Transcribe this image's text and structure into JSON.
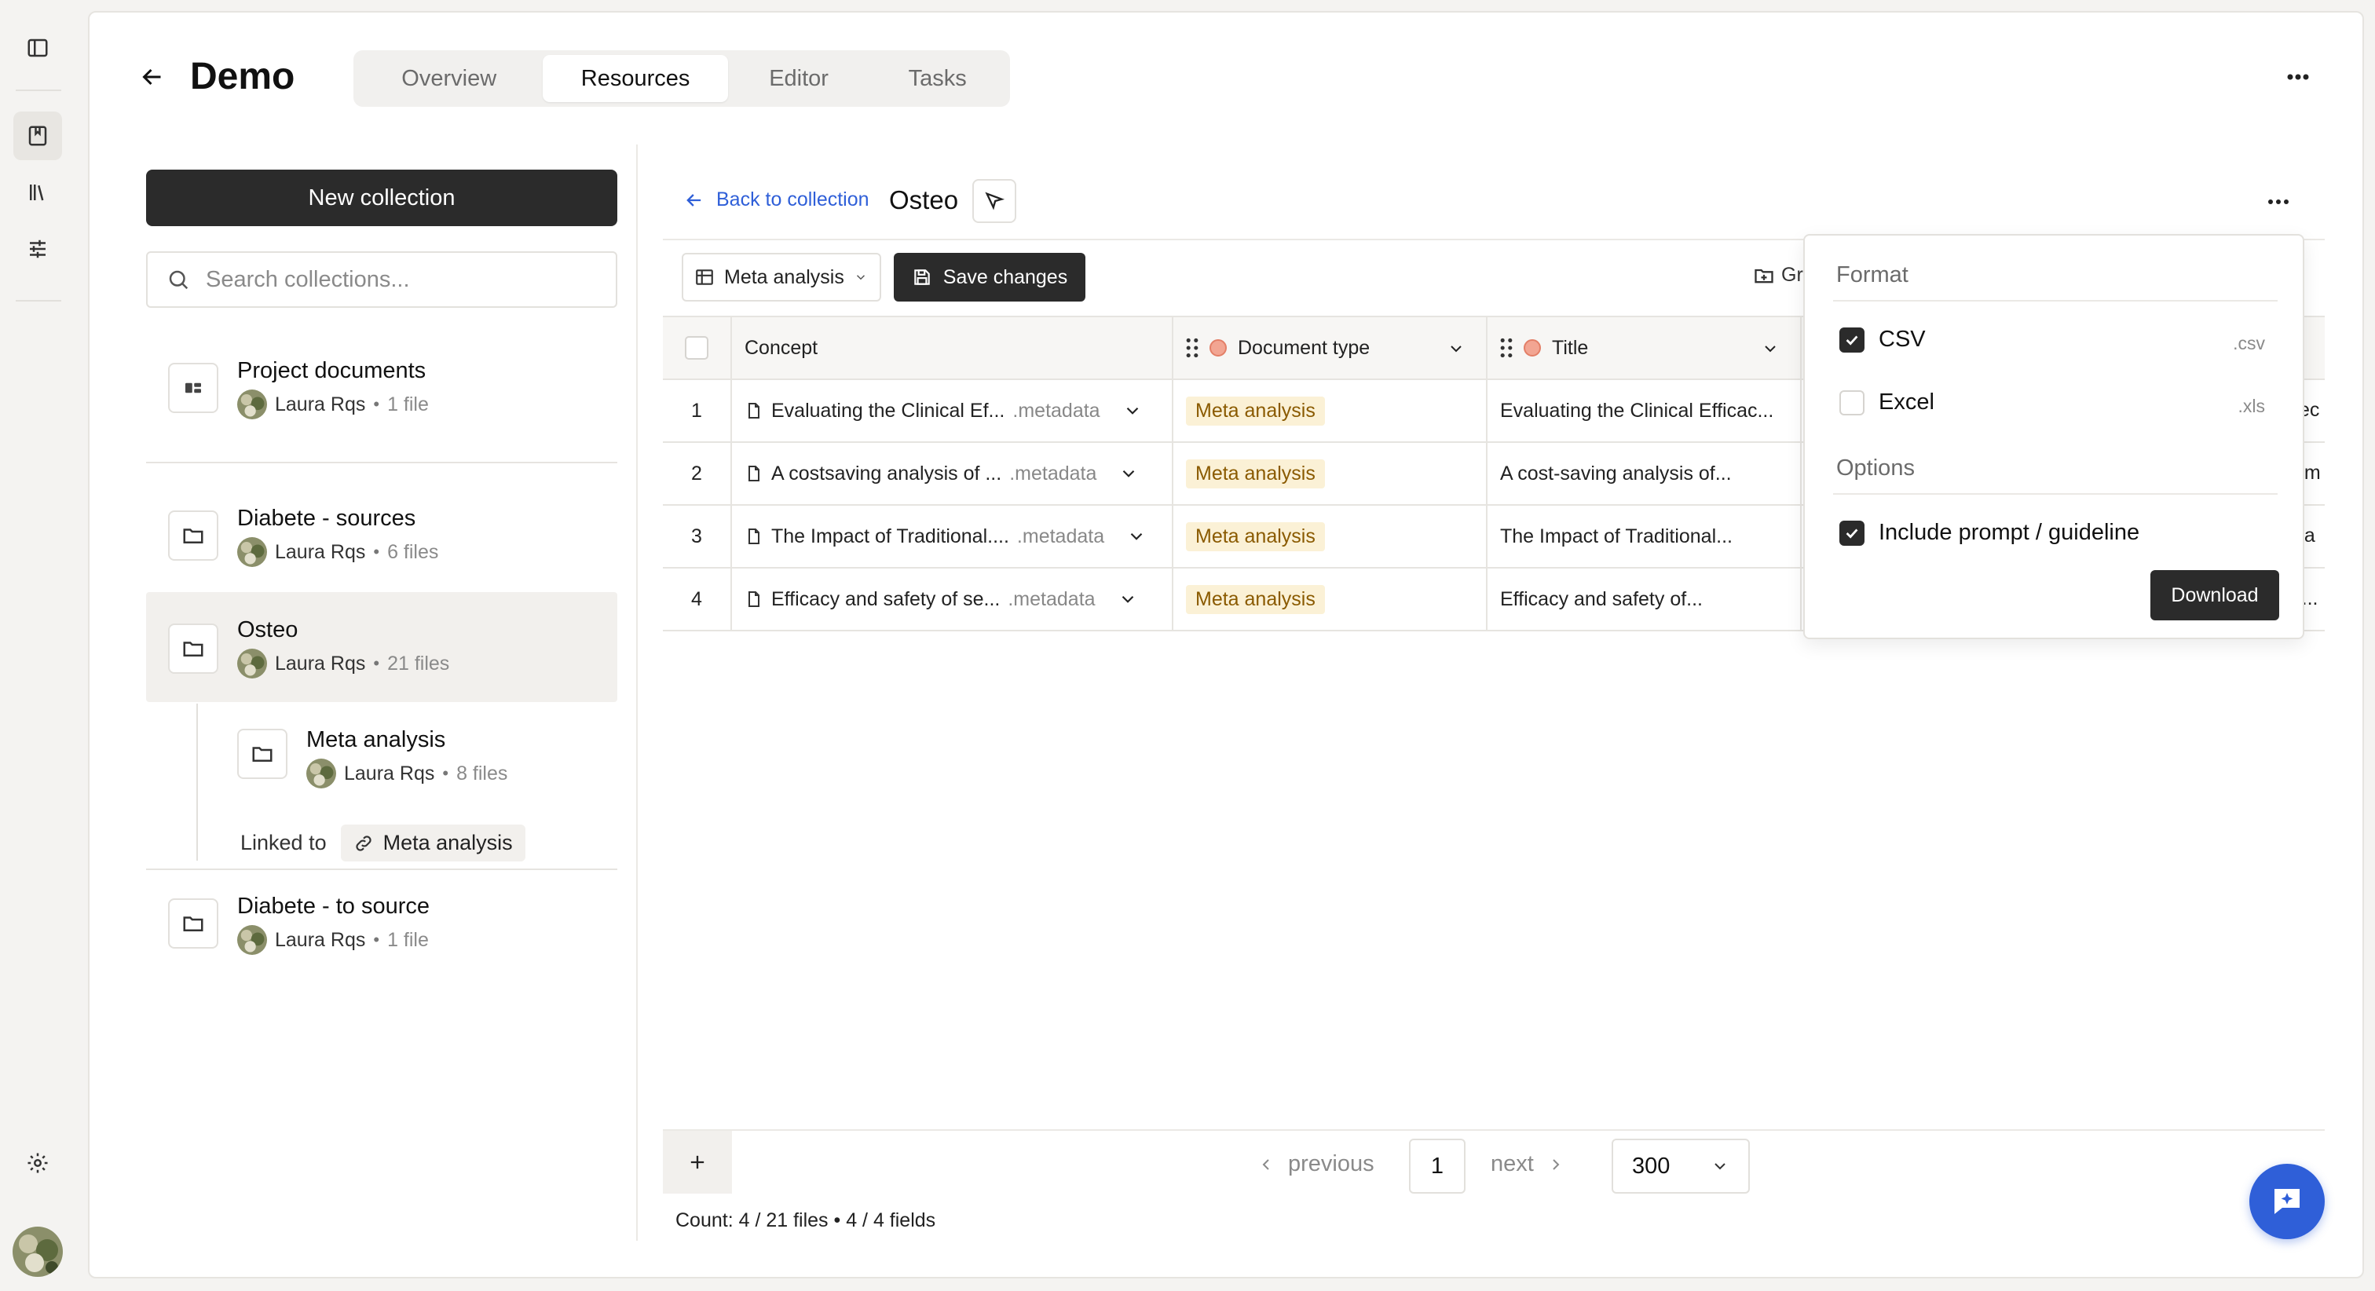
{
  "project": {
    "title": "Demo"
  },
  "tabs": [
    {
      "label": "Overview"
    },
    {
      "label": "Resources"
    },
    {
      "label": "Editor"
    },
    {
      "label": "Tasks"
    }
  ],
  "sidebar": {
    "new_collection_label": "New collection",
    "search_placeholder": "Search collections...",
    "collections": [
      {
        "name": "Project documents",
        "owner": "Laura Rqs",
        "files": "1 file"
      },
      {
        "name": "Diabete - sources",
        "owner": "Laura Rqs",
        "files": "6 files"
      },
      {
        "name": "Osteo",
        "owner": "Laura Rqs",
        "files": "21 files"
      },
      {
        "name": "Meta analysis",
        "owner": "Laura Rqs",
        "files": "8 files"
      },
      {
        "name": "Diabete - to source",
        "owner": "Laura Rqs",
        "files": "1 file"
      }
    ],
    "linked_label": "Linked to",
    "linked_target": "Meta analysis"
  },
  "pane": {
    "back_label": "Back to collection",
    "collection_title": "Osteo",
    "view_select": "Meta analysis",
    "save_label": "Save changes",
    "group_label": "Gr"
  },
  "table": {
    "columns": [
      "Concept",
      "Document type",
      "Title"
    ],
    "rows": [
      {
        "num": "1",
        "concept": "Evaluating the Clinical Ef...",
        "meta": ".metadata",
        "doctype": "Meta analysis",
        "title": "Evaluating the Clinical Efficac...",
        "rest": "tec"
      },
      {
        "num": "2",
        "concept": "A costsaving analysis of ...",
        "meta": ".metadata",
        "doctype": "Meta analysis",
        "title": "A cost-saving analysis of...",
        "rest": "om"
      },
      {
        "num": "3",
        "concept": "The Impact of Traditional....",
        "meta": ".metadata",
        "doctype": "Meta analysis",
        "title": "The Impact of Traditional...",
        "rest": "pa"
      },
      {
        "num": "4",
        "concept": "Efficacy and safety of se...",
        "meta": ".metadata",
        "doctype": "Meta analysis",
        "title": "Efficacy and safety of...",
        "rest": "y..."
      }
    ]
  },
  "pagination": {
    "previous": "previous",
    "page": "1",
    "next": "next",
    "per_page": "300",
    "count": "Count: 4 / 21 files • 4 / 4 fields"
  },
  "export_popover": {
    "format_heading": "Format",
    "options_heading": "Options",
    "formats": [
      {
        "label": "CSV",
        "ext": ".csv",
        "checked": true
      },
      {
        "label": "Excel",
        "ext": ".xls",
        "checked": false
      }
    ],
    "include_prompt_label": "Include prompt / guideline",
    "include_prompt_checked": true,
    "download_label": "Download"
  },
  "colors": {
    "accent": "#2f5fd8",
    "dark_button": "#2b2b2b",
    "badge_bg": "#fbf1d6",
    "badge_text": "#8a5a00"
  }
}
